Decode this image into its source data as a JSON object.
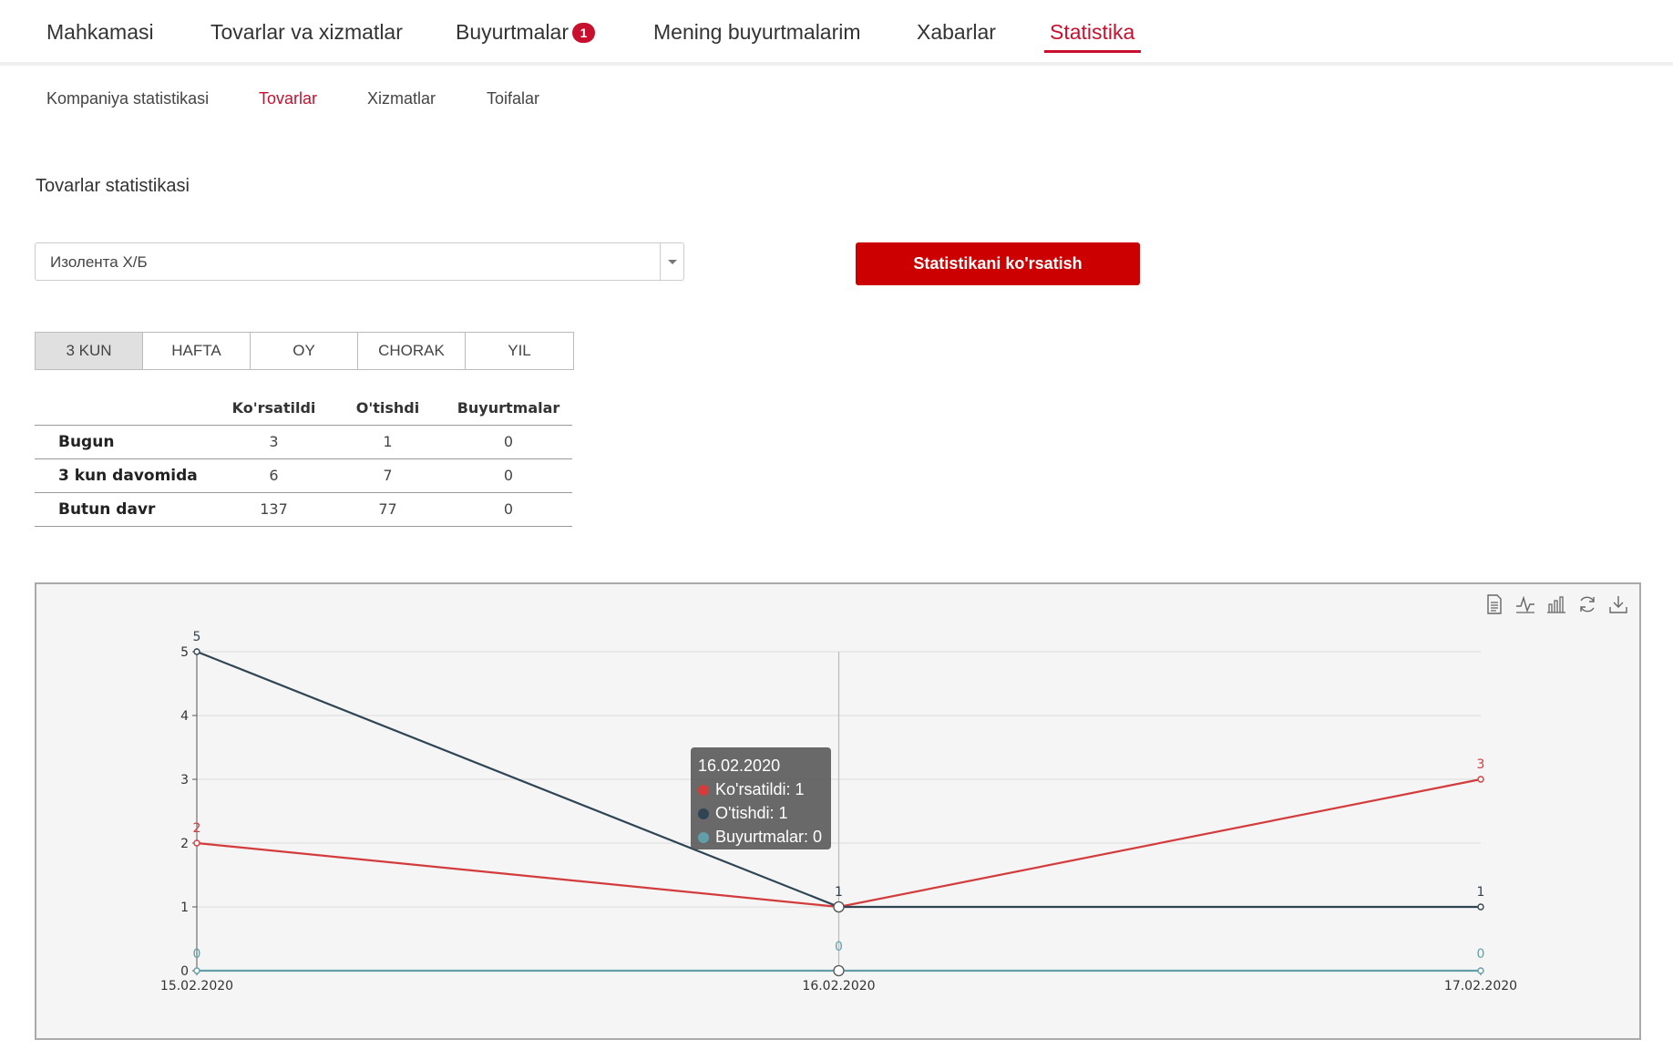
{
  "topnav": {
    "items": [
      {
        "label": "Mahkamasi"
      },
      {
        "label": "Tovarlar va xizmatlar"
      },
      {
        "label": "Buyurtmalar",
        "badge": "1"
      },
      {
        "label": "Mening buyurtmalarim"
      },
      {
        "label": "Xabarlar"
      },
      {
        "label": "Statistika",
        "active": true
      }
    ]
  },
  "subnav": {
    "items": [
      {
        "label": "Kompaniya statistikasi"
      },
      {
        "label": "Tovarlar",
        "active": true
      },
      {
        "label": "Xizmatlar"
      },
      {
        "label": "Toifalar"
      }
    ]
  },
  "section_title": "Tovarlar statistikasi",
  "product_select": {
    "value": "Изолента Х/Б"
  },
  "show_button": {
    "label": "Statistikani ko'rsatish"
  },
  "period_tabs": [
    {
      "label": "3 KUN",
      "active": true
    },
    {
      "label": "HAFTA"
    },
    {
      "label": "OY"
    },
    {
      "label": "CHORAK"
    },
    {
      "label": "YIL"
    }
  ],
  "stats_table": {
    "headers": [
      "",
      "Ko'rsatildi",
      "O'tishdi",
      "Buyurtmalar"
    ],
    "rows": [
      {
        "label": "Bugun",
        "values": [
          "3",
          "1",
          "0"
        ]
      },
      {
        "label": "3 kun davomida",
        "values": [
          "6",
          "7",
          "0"
        ]
      },
      {
        "label": "Butun davr",
        "values": [
          "137",
          "77",
          "0"
        ]
      }
    ]
  },
  "chart_toolbar": [
    "data-view-icon",
    "line-chart-icon",
    "bar-chart-icon",
    "restore-icon",
    "save-image-icon"
  ],
  "tooltip": {
    "title": "16.02.2020",
    "lines": [
      {
        "text": "Ko'rsatildi: 1",
        "color": "#d33c3c"
      },
      {
        "text": "O'tishdi: 1",
        "color": "#2f4554"
      },
      {
        "text": "Buyurtmalar: 0",
        "color": "#61a0a8"
      }
    ]
  },
  "chart_data": {
    "type": "line",
    "categories": [
      "15.02.2020",
      "16.02.2020",
      "17.02.2020"
    ],
    "series": [
      {
        "name": "Ko'rsatildi",
        "color": "#d33c3c",
        "values": [
          2,
          1,
          3
        ]
      },
      {
        "name": "O'tishdi",
        "color": "#2f4554",
        "values": [
          5,
          1,
          1
        ]
      },
      {
        "name": "Buyurtmalar",
        "color": "#61a0a8",
        "values": [
          0,
          0,
          0
        ]
      }
    ],
    "ylim": [
      0,
      5
    ],
    "yticks": [
      0,
      1,
      2,
      3,
      4,
      5
    ],
    "grid": true,
    "data_labels": true,
    "highlighted_category": "16.02.2020"
  }
}
